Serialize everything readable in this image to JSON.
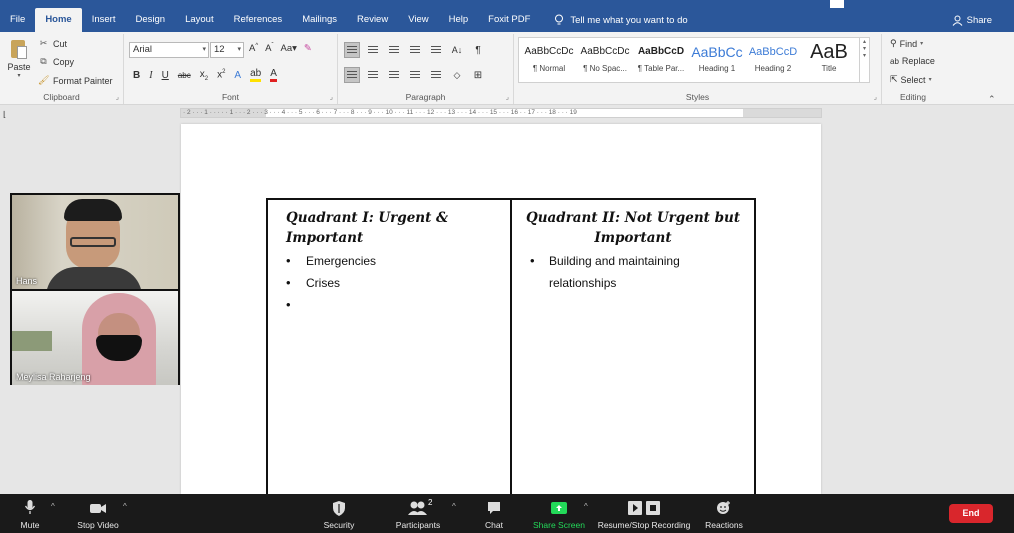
{
  "tabs": [
    "File",
    "Home",
    "Insert",
    "Design",
    "Layout",
    "References",
    "Mailings",
    "Review",
    "View",
    "Help",
    "Foxit PDF"
  ],
  "active_tab": "Home",
  "tell_me": "Tell me what you want to do",
  "share": "Share",
  "clipboard": {
    "paste": "Paste",
    "cut": "Cut",
    "copy": "Copy",
    "format_painter": "Format Painter",
    "label": "Clipboard"
  },
  "font": {
    "name": "Arial",
    "size": "12",
    "label": "Font"
  },
  "paragraph": {
    "label": "Paragraph"
  },
  "styles": {
    "label": "Styles",
    "items": [
      {
        "sample": "AaBbCcDc",
        "name": "¶ Normal"
      },
      {
        "sample": "AaBbCcDc",
        "name": "¶ No Spac..."
      },
      {
        "sample": "AaBbCcD",
        "name": "¶ Table Par..."
      },
      {
        "sample": "AaBbCc",
        "name": "Heading 1"
      },
      {
        "sample": "AaBbCcD",
        "name": "Heading 2"
      },
      {
        "sample": "AaB",
        "name": "Title"
      }
    ]
  },
  "editing": {
    "find": "Find",
    "replace": "Replace",
    "select": "Select",
    "label": "Editing"
  },
  "ruler_text": "· 2 · · · 1 · · ·   · · 1 · · · 2 · · · 3 · · · 4 · · · 5 · · · 6 · · · 7 · · · 8 · · · 9 · · · 10 · · · 11 · · · 12 · · · 13 · · · 14 · · · 15 · · · 16 ·   · 17 · · · 18 · · · 19",
  "document": {
    "q1_title": "Quadrant I: Urgent & Important",
    "q1_items": [
      "Emergencies",
      "Crises",
      ""
    ],
    "q2_title": "Quadrant II: Not Urgent but Important",
    "q2_items": [
      "Building and maintaining relationships"
    ]
  },
  "participants": [
    {
      "name": "Hans"
    },
    {
      "name": "Meylisa Raharjeng"
    }
  ],
  "zoom": {
    "mute": "Mute",
    "stop_video": "Stop Video",
    "security": "Security",
    "participants": "Participants",
    "participants_count": "2",
    "chat": "Chat",
    "share_screen": "Share Screen",
    "recording": "Resume/Stop Recording",
    "reactions": "Reactions",
    "end": "End"
  },
  "colors": {
    "word_blue": "#2b579a",
    "zoom_bar": "#1a1a1a",
    "end_red": "#d9262c",
    "share_green": "#23d959"
  }
}
